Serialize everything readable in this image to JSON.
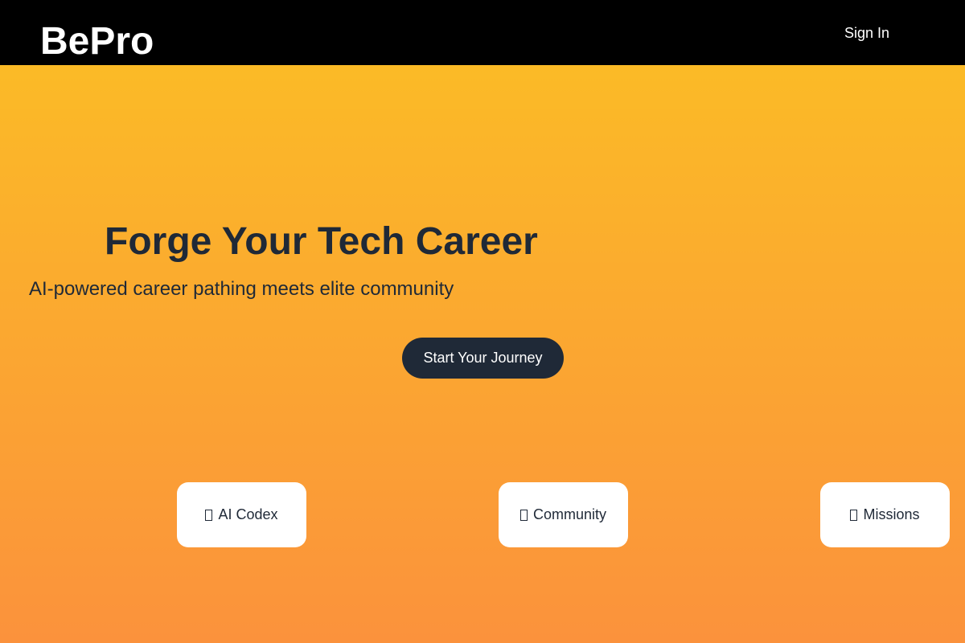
{
  "header": {
    "logo": "BePro",
    "sign_in": "Sign In"
  },
  "hero": {
    "title": "Forge Your Tech Career",
    "subtitle": "AI-powered career pathing meets elite community",
    "cta": "Start Your Journey"
  },
  "features": [
    {
      "icon": "missing-glyph",
      "label": "AI Codex"
    },
    {
      "icon": "missing-glyph",
      "label": "Community"
    },
    {
      "icon": "missing-glyph",
      "label": "Missions"
    }
  ],
  "colors": {
    "nav_background": "#000000",
    "gradient_top": "#fbbf24",
    "gradient_bottom": "#fb923c",
    "text_dark": "#1f2937",
    "button_background": "#1f2937",
    "card_background": "#ffffff"
  }
}
